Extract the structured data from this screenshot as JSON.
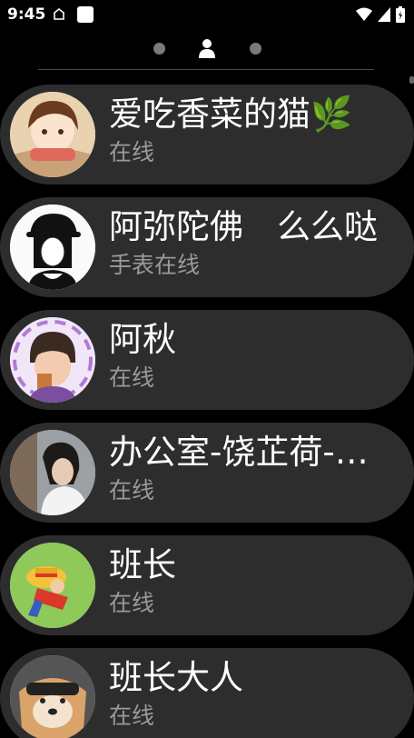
{
  "statusbar": {
    "time": "9:45"
  },
  "contacts": [
    {
      "name": "爱吃香菜的猫🌿",
      "status": "在线"
    },
    {
      "name": "阿弥陀佛　么么哒",
      "status": "手表在线"
    },
    {
      "name": "阿秋",
      "status": "在线"
    },
    {
      "name": "办公室-饶芷荷-小学",
      "status": "在线"
    },
    {
      "name": "班长",
      "status": "在线"
    },
    {
      "name": "班长大人",
      "status": "在线"
    }
  ]
}
